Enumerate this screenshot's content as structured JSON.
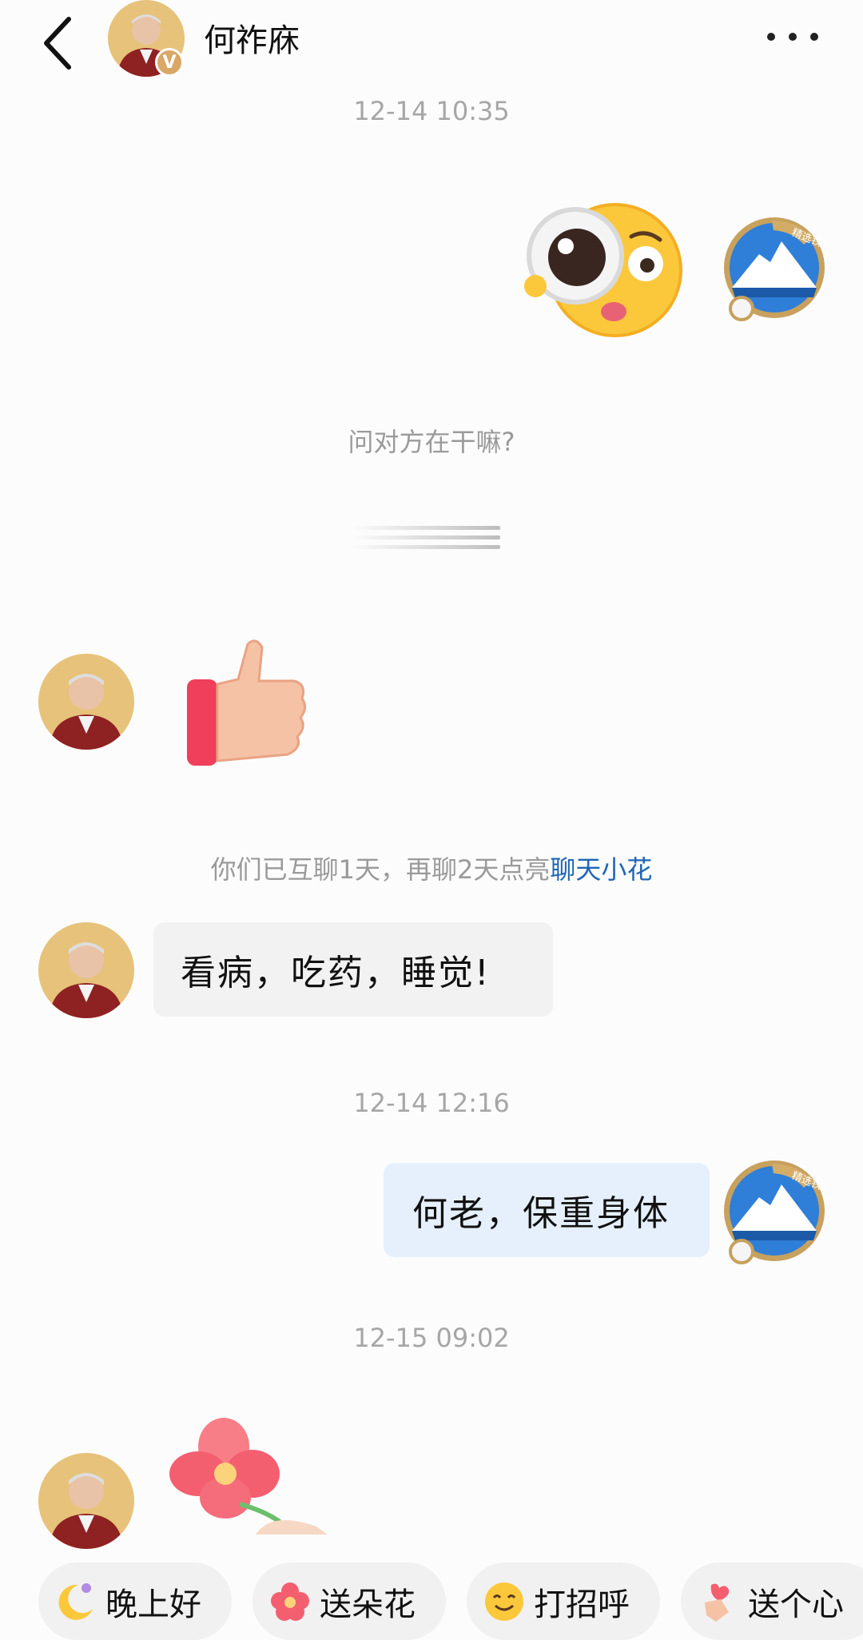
{
  "header": {
    "contact_name": "何祚庥",
    "verified_badge": "V",
    "icons": [
      "back-arrow-icon",
      "more-dots-icon"
    ]
  },
  "chat": {
    "timestamps": [
      "12-14 10:35",
      "12-14 12:16",
      "12-15 09:02"
    ],
    "prompt_text": "问对方在干嘛?",
    "streak_text": "你们已互聊1天，再聊2天点亮",
    "streak_link": "聊天小花",
    "messages": {
      "other_text": "看病，吃药，睡觉!",
      "self_text": "何老，保重身体"
    },
    "stickers": [
      "curious-emoji",
      "typing-indicator",
      "thumbs-up",
      "flower-gift"
    ],
    "avatar_badge_text": "精选铁粉"
  },
  "quick_replies": [
    {
      "label": "晚上好",
      "icon": "moon-emoji"
    },
    {
      "label": "送朵花",
      "icon": "flower-emoji"
    },
    {
      "label": "打招呼",
      "icon": "smile-emoji"
    },
    {
      "label": "送个心",
      "icon": "finger-heart-emoji"
    }
  ],
  "colors": {
    "background": "#fcfcfd",
    "bubble_other": "#f2f2f2",
    "bubble_self": "#e5f0fc",
    "link": "#1f65b5",
    "timestamp": "#a6a6a6",
    "badge": "#d9a766"
  }
}
